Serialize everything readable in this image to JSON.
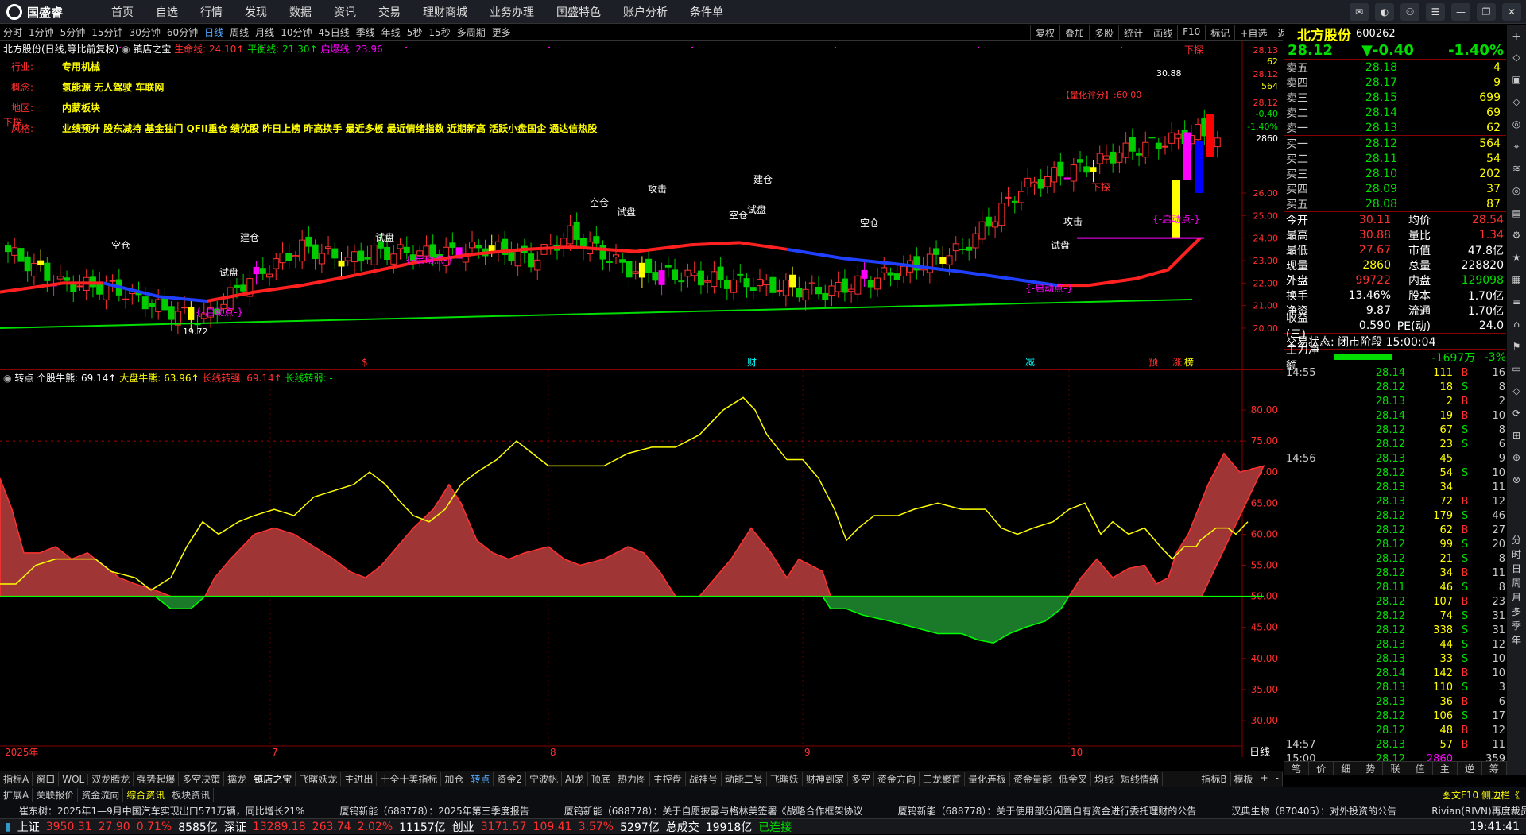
{
  "app": {
    "name": "国盛睿"
  },
  "menu": [
    "首页",
    "自选",
    "行情",
    "发现",
    "数据",
    "资讯",
    "交易",
    "理财商城",
    "业务办理",
    "国盛特色",
    "账户分析",
    "条件单"
  ],
  "periods": [
    "分时",
    "1分钟",
    "5分钟",
    "15分钟",
    "30分钟",
    "60分钟",
    "日线",
    "周线",
    "月线",
    "10分钟",
    "45日线",
    "季线",
    "年线",
    "5秒",
    "15秒",
    "多周期",
    "更多"
  ],
  "active_period": "日线",
  "tools": [
    "复权",
    "叠加",
    "多股",
    "统计",
    "画线",
    "F10",
    "标记",
    "+自选",
    "返回"
  ],
  "kline": {
    "title": "北方股份(日线,等比前复权)",
    "indicator": "镇店之宝",
    "line1_label": "生命线: 24.10↑",
    "line2_label": "平衡线: 21.30↑",
    "line3_label": "启爆线: 23.96",
    "info": [
      {
        "k": "行业:",
        "v": "专用机械"
      },
      {
        "k": "概念:",
        "v": "氢能源 无人驾驶 车联网"
      },
      {
        "k": "地区:",
        "v": "内蒙板块"
      },
      {
        "k": "风格:",
        "v": "业绩预升 股东减持 基金独门 QFII重仓 绩优股 昨日上榜 昨高换手 最近多板 最近情绪指数 近期新高 活跃小盘国企 通达信热股"
      }
    ],
    "score": "【量化评分】:60.00",
    "high_label": "30.88",
    "low_label": "19.72",
    "y_axis": [
      "28.13",
      "62",
      "28.12",
      "564",
      "28.12",
      "-0.40",
      "-1.40%",
      "2860",
      "26.00",
      "25.00",
      "24.00",
      "23.00",
      "22.00",
      "21.00",
      "20.00"
    ],
    "y_values": [
      26,
      25,
      24,
      23,
      22,
      21,
      20
    ],
    "annotations": {
      "xiatan": "下探",
      "kongcang": "空仓",
      "shipan": "试盘",
      "qidong": "{-启动点-}",
      "jiancang": "建仓",
      "gongji": "攻击"
    },
    "bottom_marks": [
      "$",
      "财",
      "减",
      "预",
      "涨",
      "榜"
    ]
  },
  "sub": {
    "title": "转点",
    "l1": "个股牛熊: 69.14↑",
    "l2": "大盘牛熊: 63.96↑",
    "l3": "长线转强: 69.14↑",
    "l4": "长线转弱: -",
    "y_axis": [
      "80.00",
      "75.00",
      "70.00",
      "65.00",
      "60.00",
      "55.00",
      "50.00",
      "45.00",
      "40.00",
      "35.00",
      "30.00"
    ],
    "x_axis": [
      "2025年",
      "7",
      "8",
      "9",
      "10"
    ]
  },
  "quote": {
    "name": "北方股份",
    "code": "600262",
    "price": "28.12",
    "change": "▼-0.40",
    "pct": "-1.40%",
    "asks": [
      {
        "l": "卖五",
        "p": "28.18",
        "v": "4"
      },
      {
        "l": "卖四",
        "p": "28.17",
        "v": "9"
      },
      {
        "l": "卖三",
        "p": "28.15",
        "v": "699"
      },
      {
        "l": "卖二",
        "p": "28.14",
        "v": "69"
      },
      {
        "l": "卖一",
        "p": "28.13",
        "v": "62"
      }
    ],
    "bids": [
      {
        "l": "买一",
        "p": "28.12",
        "v": "564"
      },
      {
        "l": "买二",
        "p": "28.11",
        "v": "54"
      },
      {
        "l": "买三",
        "p": "28.10",
        "v": "202"
      },
      {
        "l": "买四",
        "p": "28.09",
        "v": "37"
      },
      {
        "l": "买五",
        "p": "28.08",
        "v": "87"
      }
    ],
    "stats": [
      {
        "l1": "今开",
        "v1": "30.11",
        "l2": "均价",
        "v2": "28.54"
      },
      {
        "l1": "最高",
        "v1": "30.88",
        "l2": "量比",
        "v2": "1.34"
      },
      {
        "l1": "最低",
        "v1": "27.67",
        "l2": "市值",
        "v2": "47.8亿"
      },
      {
        "l1": "现量",
        "v1": "2860",
        "l2": "总量",
        "v2": "228820"
      },
      {
        "l1": "外盘",
        "v1": "99722",
        "l2": "内盘",
        "v2": "129098"
      },
      {
        "l1": "换手",
        "v1": "13.46%",
        "l2": "股本",
        "v2": "1.70亿"
      },
      {
        "l1": "净资",
        "v1": "9.87",
        "l2": "流通",
        "v2": "1.70亿"
      },
      {
        "l1": "收益(三)",
        "v1": "0.590",
        "l2": "PE(动)",
        "v2": "24.0"
      }
    ],
    "trade_status": "交易状态: 闭市阶段 15:00:04",
    "main_net_label": "主力净额",
    "main_net": "-1697万",
    "main_pct": "-3%",
    "ticks": [
      {
        "t": "14:55",
        "p": "28.14",
        "v": "111",
        "d": "B",
        "n": "16"
      },
      {
        "t": "",
        "p": "28.12",
        "v": "18",
        "d": "S",
        "n": "8"
      },
      {
        "t": "",
        "p": "28.13",
        "v": "2",
        "d": "B",
        "n": "2"
      },
      {
        "t": "",
        "p": "28.14",
        "v": "19",
        "d": "B",
        "n": "10"
      },
      {
        "t": "",
        "p": "28.12",
        "v": "67",
        "d": "S",
        "n": "8"
      },
      {
        "t": "",
        "p": "28.12",
        "v": "23",
        "d": "S",
        "n": "6"
      },
      {
        "t": "14:56",
        "p": "28.13",
        "v": "45",
        "d": "",
        "n": "9"
      },
      {
        "t": "",
        "p": "28.12",
        "v": "54",
        "d": "S",
        "n": "10"
      },
      {
        "t": "",
        "p": "28.13",
        "v": "34",
        "d": "",
        "n": "11"
      },
      {
        "t": "",
        "p": "28.13",
        "v": "72",
        "d": "B",
        "n": "12"
      },
      {
        "t": "",
        "p": "28.12",
        "v": "179",
        "d": "S",
        "n": "46"
      },
      {
        "t": "",
        "p": "28.12",
        "v": "62",
        "d": "B",
        "n": "27"
      },
      {
        "t": "",
        "p": "28.12",
        "v": "99",
        "d": "S",
        "n": "20"
      },
      {
        "t": "",
        "p": "28.12",
        "v": "21",
        "d": "S",
        "n": "8"
      },
      {
        "t": "",
        "p": "28.12",
        "v": "34",
        "d": "B",
        "n": "11"
      },
      {
        "t": "",
        "p": "28.11",
        "v": "46",
        "d": "S",
        "n": "8"
      },
      {
        "t": "",
        "p": "28.12",
        "v": "107",
        "d": "B",
        "n": "23"
      },
      {
        "t": "",
        "p": "28.12",
        "v": "74",
        "d": "S",
        "n": "31"
      },
      {
        "t": "",
        "p": "28.12",
        "v": "338",
        "d": "S",
        "n": "31"
      },
      {
        "t": "",
        "p": "28.13",
        "v": "44",
        "d": "S",
        "n": "12"
      },
      {
        "t": "",
        "p": "28.13",
        "v": "33",
        "d": "S",
        "n": "10"
      },
      {
        "t": "",
        "p": "28.14",
        "v": "142",
        "d": "B",
        "n": "10"
      },
      {
        "t": "",
        "p": "28.13",
        "v": "110",
        "d": "S",
        "n": "3"
      },
      {
        "t": "",
        "p": "28.13",
        "v": "36",
        "d": "B",
        "n": "6"
      },
      {
        "t": "",
        "p": "28.12",
        "v": "106",
        "d": "S",
        "n": "17"
      },
      {
        "t": "",
        "p": "28.12",
        "v": "48",
        "d": "B",
        "n": "12"
      },
      {
        "t": "14:57",
        "p": "28.13",
        "v": "57",
        "d": "B",
        "n": "11"
      },
      {
        "t": "15:00",
        "p": "28.12",
        "v": "2860",
        "d": "",
        "n": "359"
      }
    ],
    "bottom_tabs": [
      "笔",
      "价",
      "细",
      "势",
      "联",
      "值",
      "主",
      "逆",
      "筹"
    ]
  },
  "sidebar": [
    "分",
    "时",
    "日",
    "周",
    "月",
    "多",
    "季",
    "年"
  ],
  "bottom_tabs": [
    "指标A",
    "窗口",
    "WOL",
    "双龙腾龙",
    "强势起爆",
    "多空决策",
    "擒龙",
    "镇店之宝",
    "飞曙妖龙",
    "主进出",
    "十全十美指标",
    "加仓",
    "转点",
    "资金2",
    "宁波帆",
    "AI龙",
    "顶底",
    "热力图",
    "主控盘",
    "战神号",
    "动能二号",
    "飞曙妖",
    "财神到家",
    "多空",
    "资金方向",
    "三龙聚首",
    "量化连板",
    "资金量能",
    "低金叉",
    "均线",
    "短线情绪"
  ],
  "bottom_right": [
    "指标B",
    "模板"
  ],
  "news_left_tabs": [
    "扩展A",
    "关联报价",
    "资金流向",
    "综合资讯",
    "板块资讯"
  ],
  "news_right": "图文F10 侧边栏《",
  "news": [
    "崔东树：2025年1—9月中国汽车实现出口571万辆，同比增长21%",
    "厦钨新能（688778）：2025年第三季度报告",
    "厦钨新能（688778）：关于自愿披露与格林美签署《战略合作框架协议",
    "厦钨新能（688778）：关于使用部分闲置自有资金进行委托理财的公告",
    "汉典生物（870405）：对外投资的公告",
    "Rivian(RIVN)再度裁员之际支"
  ],
  "status": [
    {
      "l": "上证",
      "v": "3950.31",
      "c": "27.90",
      "p": "0.71%",
      "a": "8585亿"
    },
    {
      "l": "深证",
      "v": "13289.18",
      "c": "263.74",
      "p": "2.02%",
      "a": "11157亿"
    },
    {
      "l": "创业",
      "v": "3171.57",
      "c": "109.41",
      "p": "3.57%",
      "a": "5297亿"
    }
  ],
  "total_label": "总成交",
  "total": "19918亿",
  "conn": "已连接",
  "time": "19:41:41"
}
